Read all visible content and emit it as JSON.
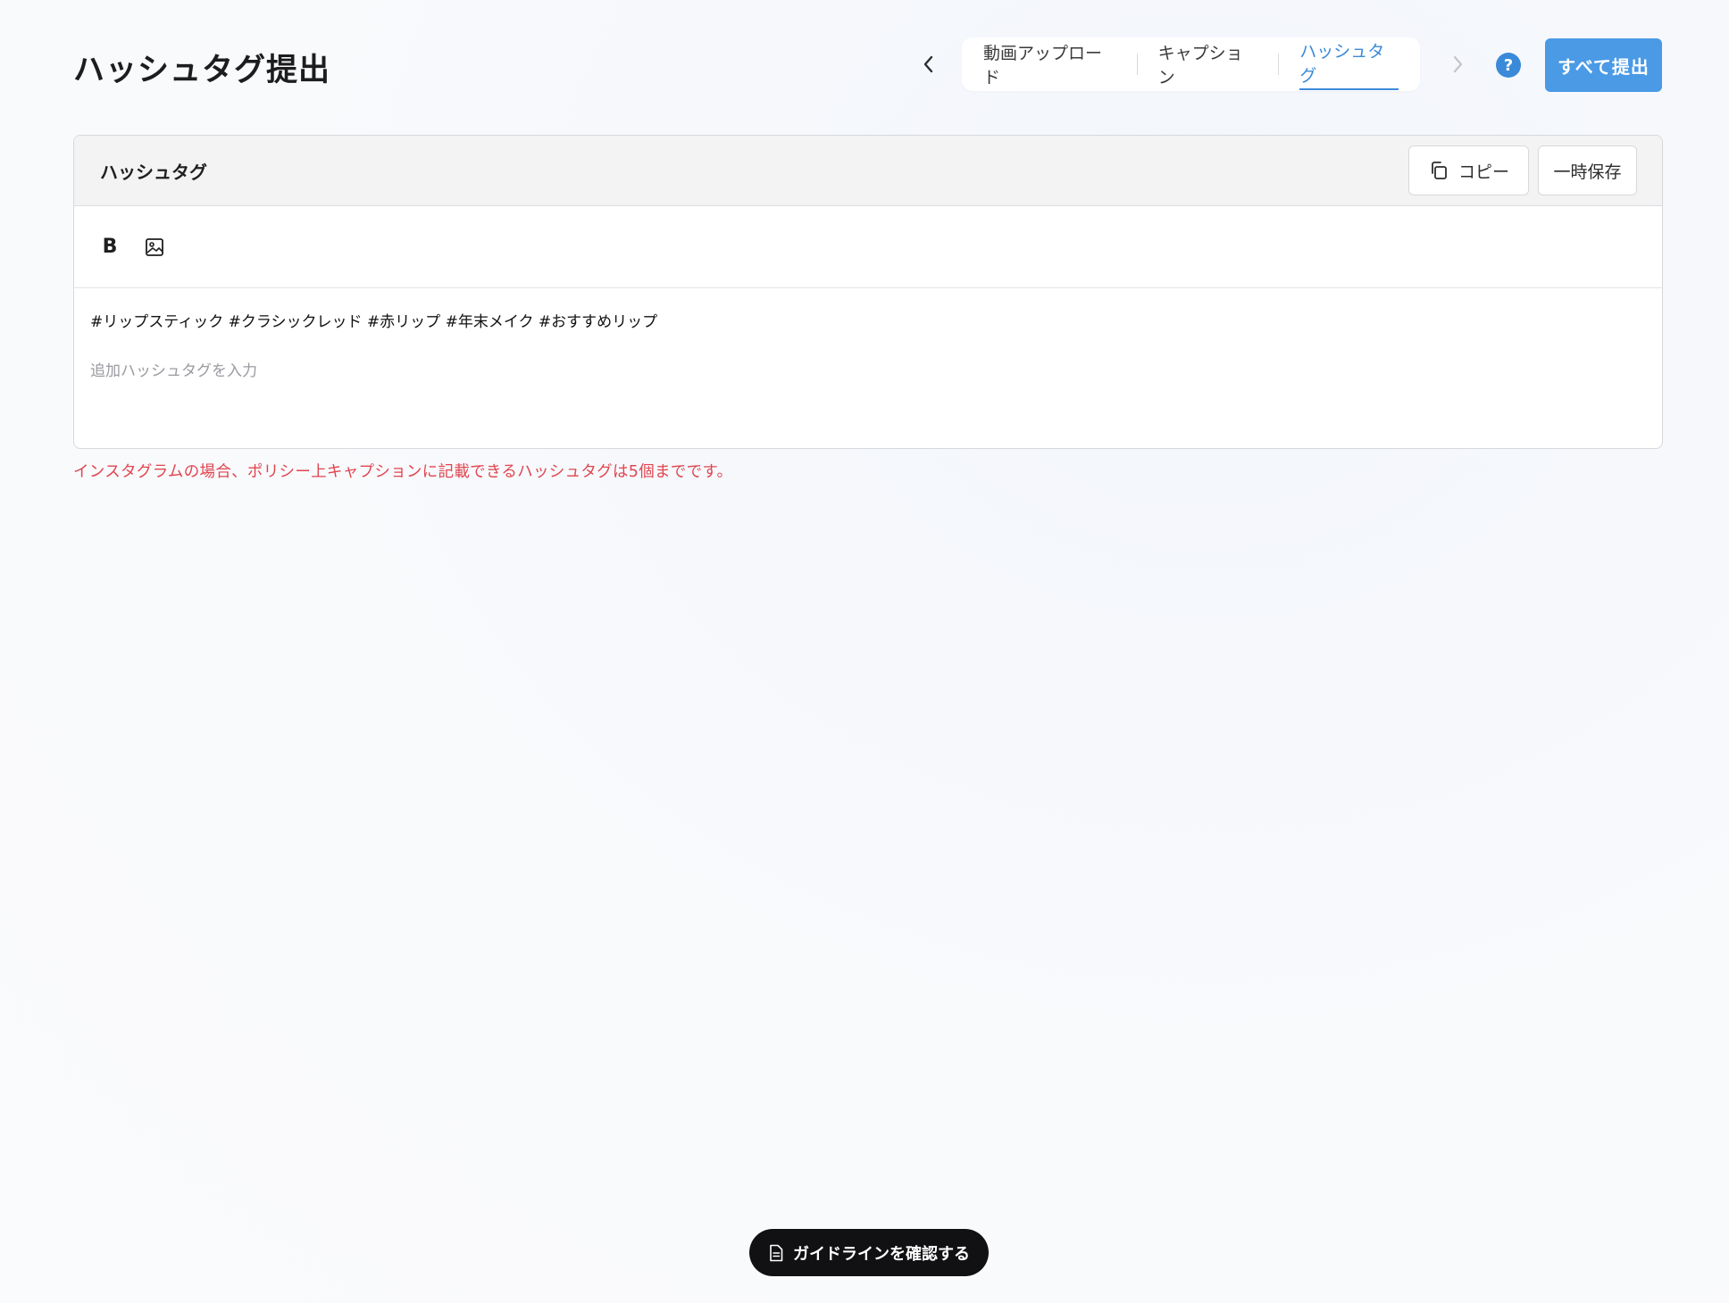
{
  "page": {
    "title": "ハッシュタグ提出"
  },
  "steps": [
    {
      "label": "動画アップロード",
      "active": false
    },
    {
      "label": "キャプション",
      "active": false
    },
    {
      "label": "ハッシュタグ",
      "active": true
    }
  ],
  "header": {
    "help_label": "?",
    "submit_all_label": "すべて提出"
  },
  "card": {
    "title": "ハッシュタグ",
    "copy_label": "コピー",
    "save_label": "一時保存",
    "bold_label": "B",
    "hashtags": "#リップスティック #クラシックレッド #赤リップ #年末メイク #おすすめリップ",
    "input_placeholder": "追加ハッシュタグを入力"
  },
  "warning": "インスタグラムの場合、ポリシー上キャプションに記載できるハッシュタグは5個までです。",
  "guide_button_label": "ガイドラインを確認する",
  "colors": {
    "accent": "#3b8ad9",
    "submit": "#4a9ae6",
    "warning": "#e0454f",
    "guide_bg": "#111113"
  },
  "icons": {
    "prev": "chevron-left-icon",
    "next": "chevron-right-icon",
    "help": "help-icon",
    "copy": "copy-icon",
    "image": "image-icon",
    "document": "document-icon"
  }
}
